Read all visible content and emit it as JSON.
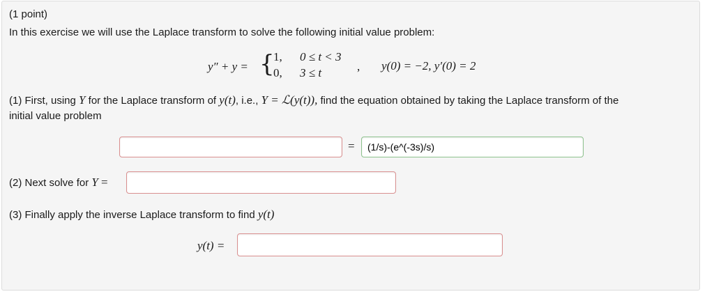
{
  "points": "(1 point)",
  "intro": "In this exercise we will use the Laplace transform to solve the following initial value problem:",
  "equation": {
    "lhs": "y″ + y =",
    "case1_val": "1,",
    "case1_cond": "0 ≤ t < 3",
    "case2_val": "0,",
    "case2_cond": "3 ≤ t",
    "comma": ",",
    "ic": "y(0) = −2, y′(0) = 2"
  },
  "part1": {
    "text_a": "(1) First, using",
    "Y": "Y",
    "text_b": "for the Laplace transform of",
    "yt": "y(t)",
    "text_c": ", i.e.,",
    "Y2": "Y",
    "eq": "= ℒ(y(t)),",
    "text_d": "find the equation obtained by taking the Laplace transform of the",
    "line2": "initial value problem",
    "left_value": "",
    "equals": "=",
    "right_value": "(1/s)-(e^(-3s)/s)"
  },
  "part2": {
    "label": "(2) Next solve for",
    "Y": "Y",
    "eq": "=",
    "value": ""
  },
  "part3": {
    "label": "(3) Finally apply the inverse Laplace transform to find",
    "yt": "y(t)",
    "answer_label": "y(t) =",
    "value": ""
  }
}
